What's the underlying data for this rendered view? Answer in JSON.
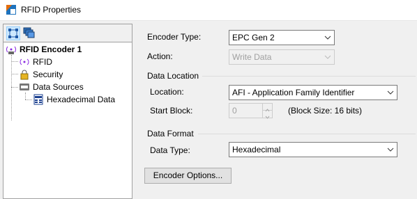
{
  "window": {
    "title": "RFID Properties"
  },
  "tree": {
    "root": "RFID Encoder 1",
    "rfid": "RFID",
    "security": "Security",
    "data_sources": "Data Sources",
    "hex_data": "Hexadecimal Data"
  },
  "form": {
    "encoder_type_label": "Encoder Type:",
    "encoder_type_value": "EPC Gen 2",
    "action_label": "Action:",
    "action_value": "Write Data",
    "data_location_group": "Data Location",
    "location_label": "Location:",
    "location_value": "AFI - Application Family Identifier",
    "start_block_label": "Start Block:",
    "start_block_value": "0",
    "block_size_text": "(Block Size: 16 bits)",
    "data_format_group": "Data Format",
    "data_type_label": "Data Type:",
    "data_type_value": "Hexadecimal",
    "encoder_options_button": "Encoder Options..."
  },
  "icons": {
    "title": "app-logo-icon",
    "toolbar": [
      "tree-view-icon",
      "cascade-windows-icon"
    ],
    "tree": [
      "rfid-encoder-icon",
      "rfid-signal-icon",
      "lock-icon",
      "data-source-icon",
      "hexadecimal-data-icon"
    ]
  }
}
